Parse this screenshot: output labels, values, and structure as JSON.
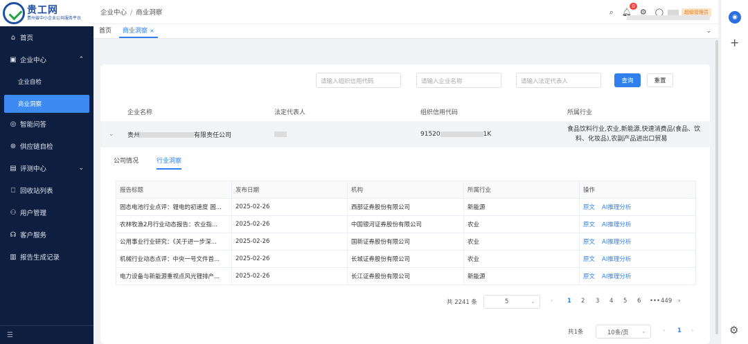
{
  "logo": {
    "name": "贵工网",
    "subtitle": "贵州省中小企业公共服务平台"
  },
  "sidebar": {
    "items": [
      {
        "icon": "home-icon",
        "glyph": "⌂",
        "label": "首页"
      },
      {
        "icon": "enterprise-icon",
        "glyph": "▣",
        "label": "企业中心",
        "expanded": true
      },
      {
        "label": "企业自检",
        "sub": true
      },
      {
        "label": "商业洞察",
        "sub": true,
        "active": true
      },
      {
        "icon": "qa-icon",
        "glyph": "◎",
        "label": "智能问答"
      },
      {
        "icon": "supply-chain-icon",
        "glyph": "⊛",
        "label": "供应链自检"
      },
      {
        "icon": "evaluation-icon",
        "glyph": "▤",
        "label": "评测中心",
        "collapsed": true
      },
      {
        "icon": "recycle-icon",
        "glyph": "⎕",
        "label": "回收站列表"
      },
      {
        "icon": "user-icon",
        "glyph": "⚇",
        "label": "用户管理"
      },
      {
        "icon": "headset-icon",
        "glyph": "☊",
        "label": "客户服务"
      },
      {
        "icon": "report-icon",
        "glyph": "▥",
        "label": "报告生成记录"
      }
    ]
  },
  "breadcrumb": {
    "root": "企业中心",
    "current": "商业洞察"
  },
  "header": {
    "notification_count": "0",
    "role": "超级管理员"
  },
  "tabs": {
    "home": "首页",
    "current": "商业洞察"
  },
  "search": {
    "credit_code_placeholder": "请输入组织信用代码",
    "name_placeholder": "请输入企业名称",
    "legal_placeholder": "请输入法定代表人",
    "query_label": "查询",
    "reset_label": "重置"
  },
  "enterprise": {
    "headers": {
      "name": "企业名称",
      "legal": "法定代表人",
      "code": "组织信用代码",
      "industry": "所属行业"
    },
    "row": {
      "name_prefix": "贵州",
      "name_suffix": "有限责任公司",
      "code_prefix": "91520",
      "code_suffix": "1K",
      "industry_line1": "食品饮料行业,农业,新能源,快速消费品(食品、饮",
      "industry_line2": "料、化妆品),农副产品进出口贸易"
    }
  },
  "subtabs": {
    "overview": "公司情况",
    "insight": "行业洞察"
  },
  "reports": {
    "headers": {
      "title": "报告标题",
      "date": "发布日期",
      "org": "机构",
      "industry": "所属行业",
      "action": "操作"
    },
    "action_labels": {
      "original": "原文",
      "ai": "AI推理分析"
    },
    "rows": [
      {
        "title": "固态电池行业点评：锂电的初速度 固...",
        "date": "2025-02-26",
        "org": "西部证券股份有限公司",
        "industry": "新能源"
      },
      {
        "title": "农林牧渔2月行业动态报告：农业指...",
        "date": "2025-02-26",
        "org": "中国银河证券股份有限公司",
        "industry": "农业"
      },
      {
        "title": "公用事业行业研究：《关于进一步深...",
        "date": "2025-02-26",
        "org": "国新证券股份有限公司",
        "industry": "农业"
      },
      {
        "title": "机械行业动态点评：中央一号文件首...",
        "date": "2025-02-26",
        "org": "长城证券股份有限公司",
        "industry": "农业"
      },
      {
        "title": "电力设备与新能源重视点风光锂排产...",
        "date": "2025-02-26",
        "org": "长江证券股份有限公司",
        "industry": "新能源"
      }
    ]
  },
  "report_pager": {
    "total": "共 2241 条",
    "page_size": "5",
    "prev": "‹",
    "next": "›",
    "pages": [
      {
        "n": "1",
        "active": true
      },
      {
        "n": "2"
      },
      {
        "n": "3"
      },
      {
        "n": "4"
      },
      {
        "n": "5"
      },
      {
        "n": "6"
      },
      {
        "n": "•••"
      },
      {
        "n": "449"
      }
    ]
  },
  "ent_pager": {
    "total": "共1条",
    "page_size": "10条/页",
    "page": "1",
    "prev": "‹",
    "next": "›"
  }
}
